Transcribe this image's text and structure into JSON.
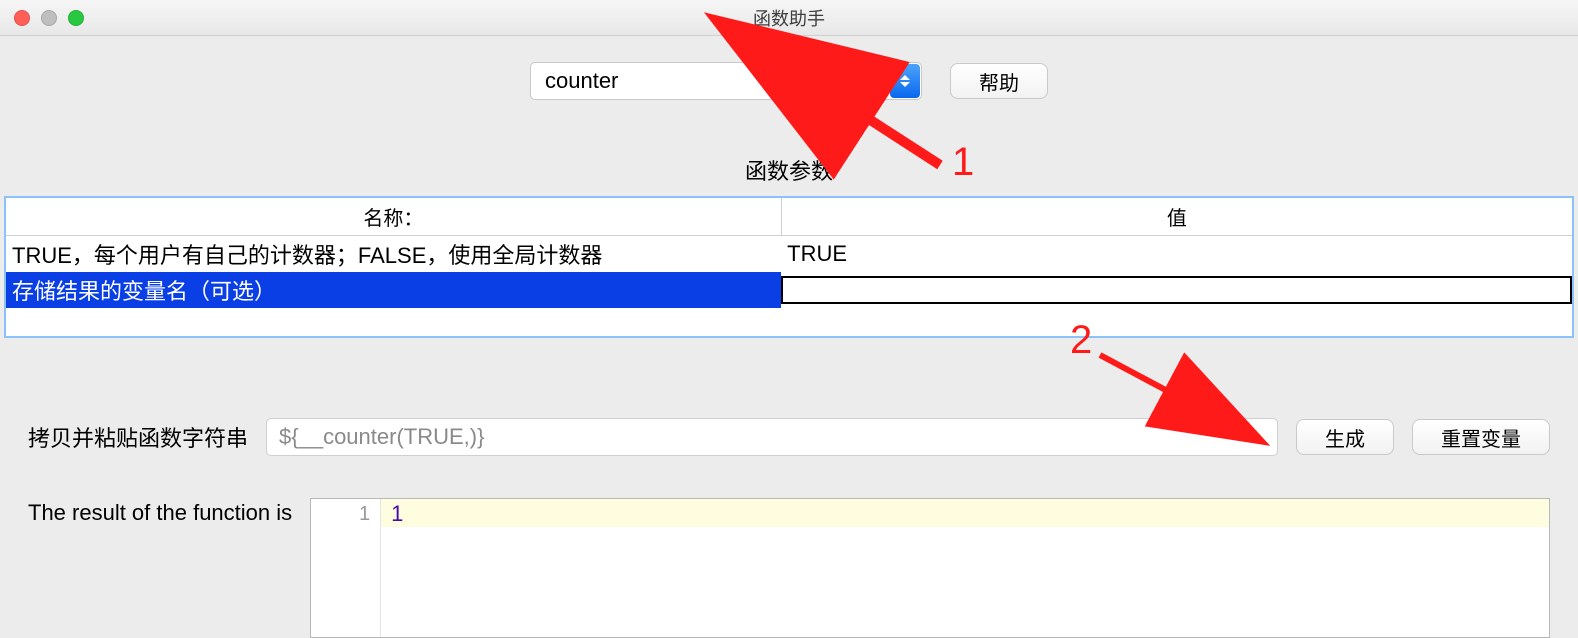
{
  "window": {
    "title": "函数助手"
  },
  "topbar": {
    "function_select": "counter",
    "help_button": "帮助"
  },
  "params": {
    "section_title": "函数参数",
    "columns": {
      "name": "名称：",
      "value": "值"
    },
    "rows": [
      {
        "name": "TRUE，每个用户有自己的计数器；FALSE，使用全局计数器",
        "value": "TRUE",
        "selected": false
      },
      {
        "name": "存储结果的变量名（可选）",
        "value": "",
        "selected": true,
        "editing": true
      }
    ]
  },
  "function_string": {
    "label": "拷贝并粘贴函数字符串",
    "value": "${__counter(TRUE,)}",
    "generate_button": "生成",
    "reset_button": "重置变量"
  },
  "result": {
    "label": "The result of the function is",
    "line_number": "1",
    "value": "1"
  },
  "annotations": {
    "one": "1",
    "two": "2"
  }
}
